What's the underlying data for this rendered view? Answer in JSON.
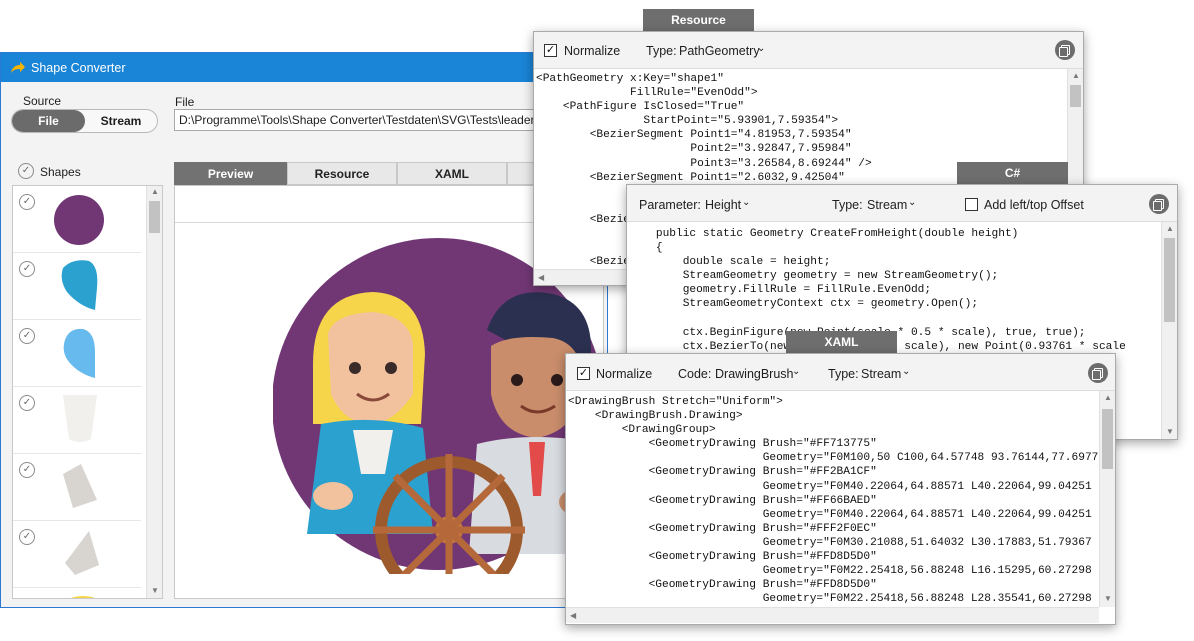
{
  "main": {
    "title": "Shape Converter",
    "source_label": "Source",
    "source_options": [
      "File",
      "Stream"
    ],
    "file_label": "File",
    "file_path": "D:\\Programme\\Tools\\Shape Converter\\Testdaten\\SVG\\Tests\\leader.s",
    "shapes_label": "Shapes",
    "tabs": [
      "Preview",
      "Resource",
      "XAML",
      ""
    ]
  },
  "resource_panel": {
    "tab": "Resource",
    "normalize_label": "Normalize",
    "type_label": "Type:",
    "type_value": "PathGeometry",
    "code": "<PathGeometry x:Key=\"shape1\"\n              FillRule=\"EvenOdd\">\n    <PathFigure IsClosed=\"True\"\n                StartPoint=\"5.93901,7.59354\">\n        <BezierSegment Point1=\"4.81953,7.59354\"\n                       Point2=\"3.92847,7.95984\"\n                       Point3=\"3.26584,8.69244\" />\n        <BezierSegment Point1=\"2.6032,9.42504\"\n\n\n        <BezierSegment\n\n\n        <BezierSegment"
  },
  "csharp_panel": {
    "tab": "C#",
    "parameter_label": "Parameter:",
    "parameter_value": "Height",
    "type_label": "Type:",
    "type_value": "Stream",
    "offset_label": "Add left/top Offset",
    "code": "    public static Geometry CreateFromHeight(double height)\n    {\n        double scale = height;\n        StreamGeometry geometry = new StreamGeometry();\n        geometry.FillRule = FillRule.EvenOdd;\n        StreamGeometryContext ctx = geometry.Open();\n\n        ctx.BeginFigure(new Point(scale * 0.5 * scale), true, true);\n        ctx.BezierTo(new Point(0.64577 * scale), new Point(0.93761 * scale\n                                                                t(0.8233\n                                                                t(0.796\n                                                                t(0.7648\n                                                                t(0.737\n                                                                t(0.713"
  },
  "xaml_panel": {
    "tab": "XAML",
    "normalize_label": "Normalize",
    "code_label": "Code:",
    "code_value": "DrawingBrush",
    "type_label": "Type:",
    "type_value": "Stream",
    "code": "<DrawingBrush Stretch=\"Uniform\">\n    <DrawingBrush.Drawing>\n        <DrawingGroup>\n            <GeometryDrawing Brush=\"#FF713775\"\n                             Geometry=\"F0M100,50 C100,64.57748 93.76144,77.69775\n            <GeometryDrawing Brush=\"#FF2BA1CF\"\n                             Geometry=\"F0M40.22064,64.88571 L40.22064,99.04251 C3\n            <GeometryDrawing Brush=\"#FF66BAED\"\n                             Geometry=\"F0M40.22064,64.88571 L40.22064,99.04251 C3\n            <GeometryDrawing Brush=\"#FFF2F0EC\"\n                             Geometry=\"F0M30.21088,51.64032 L30.17883,51.79367 L2\n            <GeometryDrawing Brush=\"#FFD8D5D0\"\n                             Geometry=\"F0M22.25418,56.88248 L16.15295,60.27298 L1\n            <GeometryDrawing Brush=\"#FFD8D5D0\"\n                             Geometry=\"F0M22.25418,56.88248 L28.35541,60.27298 L3"
  },
  "colors": {
    "title_bar": "#1a84d6",
    "tab_selected": "#727272",
    "shape_purple": "#713775",
    "shape_blue": "#2ba1cf",
    "shape_lightblue": "#66baed"
  }
}
